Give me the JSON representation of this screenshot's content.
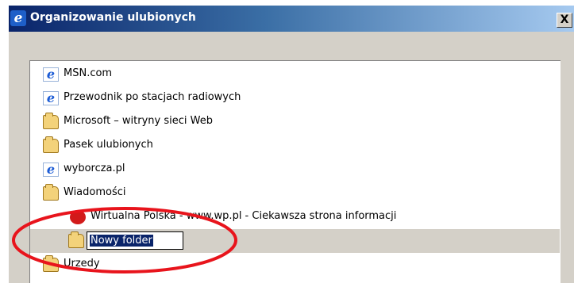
{
  "window": {
    "title": "Organizowanie ulubionych",
    "close_glyph": "X",
    "title_icon_glyph": "e"
  },
  "favorites": {
    "items": [
      {
        "label": "MSN.com",
        "icon": "ie-icon"
      },
      {
        "label": "Przewodnik po stacjach radiowych",
        "icon": "ie-icon"
      },
      {
        "label": "Microsoft – witryny sieci Web",
        "icon": "folder-icon"
      },
      {
        "label": "Pasek ulubionych",
        "icon": "folder-icon"
      },
      {
        "label": "wyborcza.pl",
        "icon": "ie-icon"
      },
      {
        "label": "Wiadomości",
        "icon": "folder-icon"
      },
      {
        "label": "Wirtualna Polska - www.wp.pl - Ciekawsza strona informacji",
        "icon": "wp-icon"
      },
      {
        "label": "Nowy folder",
        "icon": "folder-icon",
        "editing": true
      },
      {
        "label": "Urzedy",
        "icon": "folder-icon"
      }
    ],
    "ie_glyph": "e"
  },
  "annotation": {
    "color": "#e8141c"
  }
}
